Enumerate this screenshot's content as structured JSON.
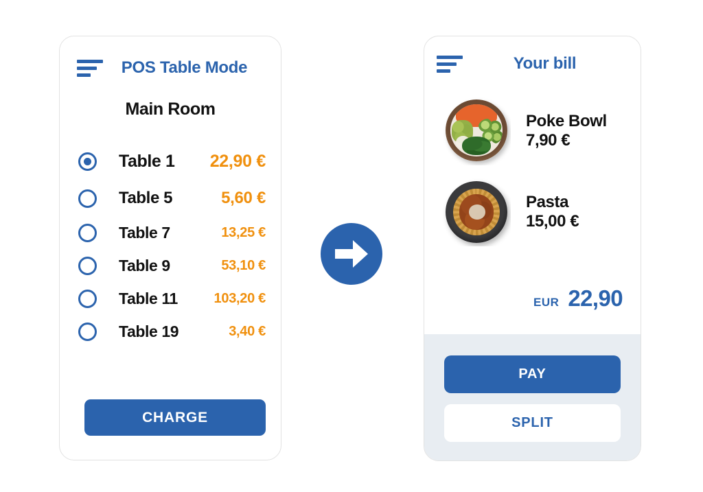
{
  "pos_panel": {
    "menu_icon": "hamburger-icon",
    "title": "POS Table Mode",
    "room_title": "Main Room",
    "tables": [
      {
        "name": "Table 1",
        "amount": "22,90 €",
        "selected": true
      },
      {
        "name": "Table 5",
        "amount": "5,60 €",
        "selected": false
      },
      {
        "name": "Table 7",
        "amount": "13,25 €",
        "selected": false
      },
      {
        "name": "Table 9",
        "amount": "53,10 €",
        "selected": false
      },
      {
        "name": "Table 11",
        "amount": "103,20 €",
        "selected": false
      },
      {
        "name": "Table 19",
        "amount": "3,40 €",
        "selected": false
      }
    ],
    "charge_label": "CHARGE"
  },
  "arrow": {
    "icon": "arrow-right-icon"
  },
  "bill_panel": {
    "menu_icon": "hamburger-icon",
    "title": "Your bill",
    "items": [
      {
        "name": "Poke Bowl",
        "price": "7,90 €",
        "image": "poke-bowl-photo"
      },
      {
        "name": "Pasta",
        "price": "15,00 €",
        "image": "pasta-photo"
      }
    ],
    "total_currency": "EUR",
    "total_amount": "22,90",
    "pay_label": "PAY",
    "split_label": "SPLIT"
  },
  "colors": {
    "brand_blue": "#2b63ad",
    "accent_orange": "#f0900e",
    "footer_grey": "#e8edf2",
    "text_dark": "#111111",
    "card_border": "#e2e2e2"
  }
}
